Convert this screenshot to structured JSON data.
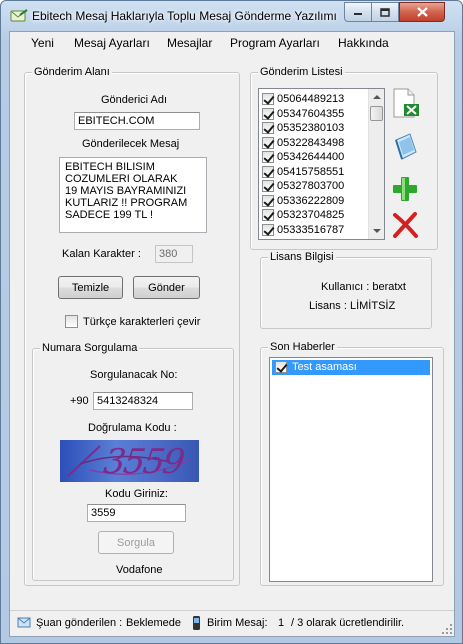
{
  "window": {
    "title": "Ebitech Mesaj Haklarıyla Toplu Mesaj Gönderme Yazılımı"
  },
  "menu": [
    "Yeni",
    "Mesaj Ayarları",
    "Mesajlar",
    "Program Ayarları",
    "Hakkında"
  ],
  "gonderim_alani": {
    "title": "Gönderim Alanı",
    "sender_label": "Gönderici Adı",
    "sender_value": "EBITECH.COM",
    "message_label": "Gönderilecek Mesaj",
    "message_lines": [
      "EBITECH BILISIM",
      "COZUMLERI OLARAK",
      "19 MAYIS BAYRAMINIZI",
      "KUTLARIZ !! PROGRAM",
      "SADECE 199 TL !"
    ],
    "remaining_label": "Kalan Karakter :",
    "remaining_value": "380",
    "clear_button": "Temizle",
    "send_button": "Gönder",
    "turkish_chars_label": "Türkçe karakterleri çevir"
  },
  "numara_sorgulama": {
    "title": "Numara Sorgulama",
    "query_label": "Sorgulanacak No:",
    "prefix": "+90",
    "number_value": "5413248324",
    "verify_label": "Doğrulama Kodu :",
    "captcha_text": "3559",
    "code_label": "Kodu Giriniz:",
    "code_value": "3559",
    "query_button": "Sorgula",
    "operator": "Vodafone"
  },
  "gonderim_listesi": {
    "title": "Gönderim Listesi",
    "numbers": [
      "05064489213",
      "05347604355",
      "05352380103",
      "05322843498",
      "05342644400",
      "05415758551",
      "05327803700",
      "05336222809",
      "05323704825",
      "05333516787"
    ]
  },
  "tools": [
    "excel-import-icon",
    "notepad-icon",
    "add-icon",
    "delete-icon"
  ],
  "lisans": {
    "title": "Lisans Bilgisi",
    "user_line": "Kullanıcı : beratxt",
    "license_line": "Lisans : LİMİTSİZ"
  },
  "son_haberler": {
    "title": "Son Haberler",
    "items": [
      "Test asaması"
    ]
  },
  "status": {
    "sending_label": "Şuan gönderilen :",
    "sending_value": "Beklemede",
    "unit_label": "Birim Mesaj:",
    "unit_value": "1",
    "unit_suffix": "/ 3 olarak ücretlendirilir."
  },
  "colors": {
    "selection": "#3399ff",
    "excel_green": "#1f8a2e",
    "add_green": "#2fa82f",
    "delete_red": "#d42020"
  }
}
